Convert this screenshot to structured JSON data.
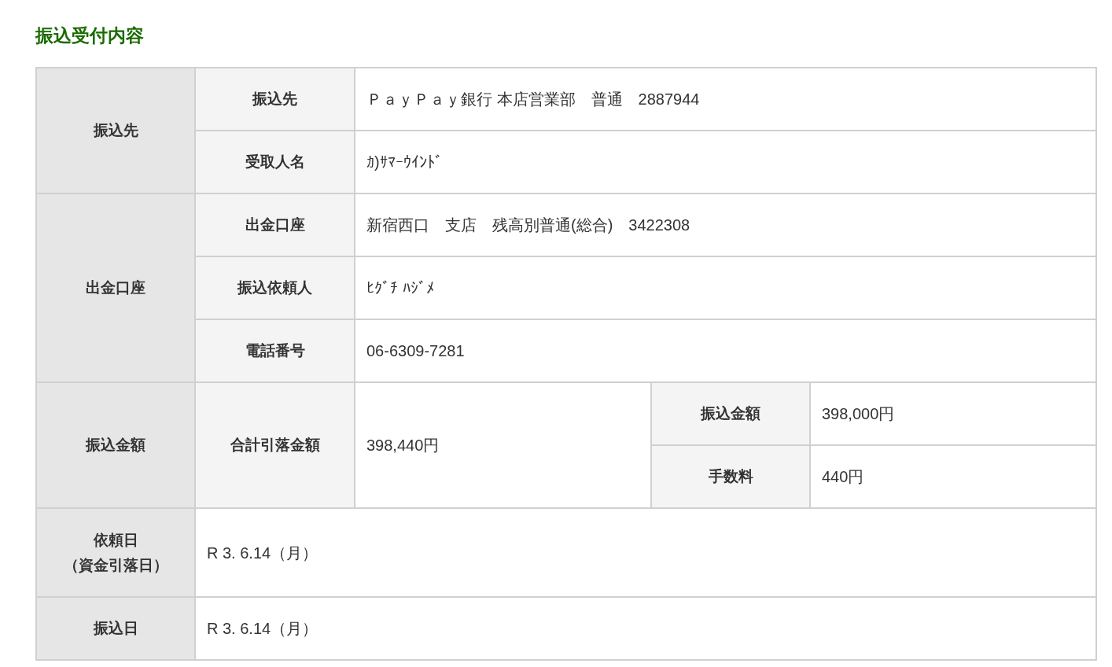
{
  "title": "振込受付内容",
  "sections": [
    {
      "kind": "group",
      "heading": "振込先",
      "rows": [
        {
          "label": "振込先",
          "value": "ＰａｙＰａｙ銀行 本店営業部　普通　2887944"
        },
        {
          "label": "受取人名",
          "value": "ｶ)ｻﾏｰｳｲﾝﾄﾞ"
        }
      ]
    },
    {
      "kind": "group",
      "heading": "出金口座",
      "rows": [
        {
          "label": "出金口座",
          "value": "新宿西口　支店　残高別普通(総合)　3422308"
        },
        {
          "label": "振込依頼人",
          "value": "ﾋｸﾞﾁ ﾊｼﾞﾒ"
        },
        {
          "label": "電話番号",
          "value": "06-6309-7281"
        }
      ]
    },
    {
      "kind": "amount",
      "heading": "振込金額",
      "label": "合計引落金額",
      "value": "398,440円",
      "breakdown": [
        {
          "label": "振込金額",
          "value": "398,000円"
        },
        {
          "label": "手数料",
          "value": "440円"
        }
      ]
    },
    {
      "kind": "single",
      "heading_lines": [
        "依頼日",
        "（資金引落日）"
      ],
      "value": "R 3. 6.14（月）"
    },
    {
      "kind": "single",
      "heading_lines": [
        "振込日"
      ],
      "value": "R 3. 6.14（月）"
    }
  ]
}
